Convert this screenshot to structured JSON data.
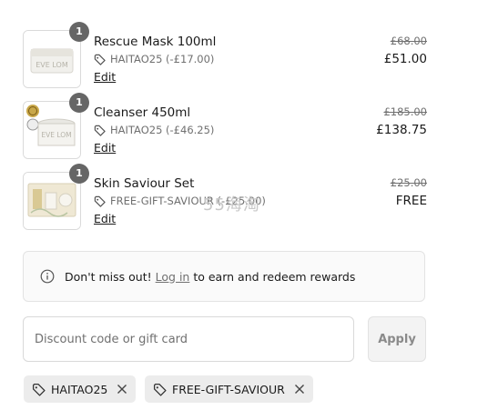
{
  "items": [
    {
      "quantity": "1",
      "title": "Rescue Mask 100ml",
      "discount": "HAITAO25 (-£17.00)",
      "edit_label": "Edit",
      "old_price": "£68.00",
      "price": "£51.00",
      "product_label": "EVE LOM"
    },
    {
      "quantity": "1",
      "title": "Cleanser 450ml",
      "discount": "HAITAO25 (-£46.25)",
      "edit_label": "Edit",
      "old_price": "£185.00",
      "price": "£138.75",
      "product_label": "EVE LOM"
    },
    {
      "quantity": "1",
      "title": "Skin Saviour Set",
      "discount": "FREE-GIFT-SAVIOUR (-£25.00)",
      "edit_label": "Edit",
      "old_price": "£25.00",
      "price": "FREE"
    }
  ],
  "watermark": "55海淘",
  "notice": {
    "prefix": "Don't miss out!",
    "link": "Log in",
    "suffix": "to earn and redeem rewards"
  },
  "discount_field": {
    "placeholder": "Discount code or gift card",
    "value": ""
  },
  "apply_label": "Apply",
  "applied_codes": [
    "HAITAO25",
    "FREE-GIFT-SAVIOUR"
  ],
  "colors": {
    "badge": "#666666",
    "muted_text": "#707070",
    "chip_bg": "#ececec"
  }
}
